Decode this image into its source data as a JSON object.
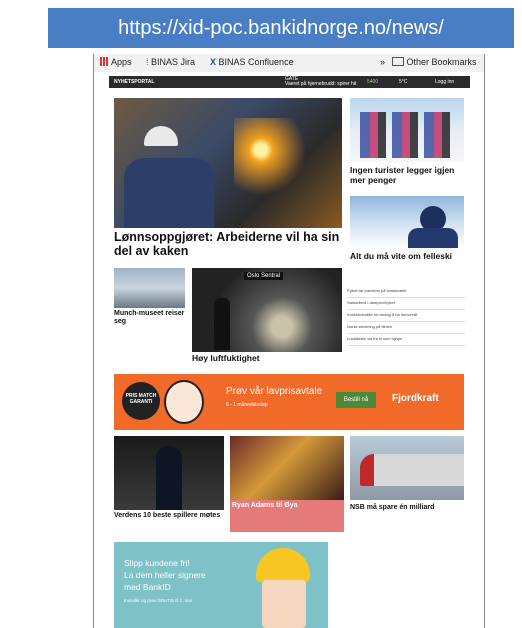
{
  "url": "https://xid-poc.bankidnorge.no/news/",
  "bookmarks": {
    "apps": "Apps",
    "jira": "BINAS Jira",
    "confluence": "BINAS Confluence",
    "more": "»",
    "other": "Other Bookmarks"
  },
  "site": {
    "name": "NYHETSPORTAL",
    "date_label": "GATE",
    "ticker": "Vaeret på hjernebrudd: spirer hit",
    "time": "11:30",
    "stat1": "5400",
    "stat2": "5°C",
    "stat3": "Logg inn"
  },
  "articles": {
    "main": "Lønnsoppgjøret: Arbeiderne vil ha sin del av kaken",
    "tourists": "Ingen turister legger igjen mer penger",
    "felleski": "Alt du må vite om felleski",
    "munch": "Munch-museet reiser seg",
    "luft": "Høy luftfuktighet",
    "oslo_sentral": "Oslo Sentral",
    "players": "Verdens 10 beste spillere møtes",
    "ryan": "Ryan Adams til Øya",
    "nsb": "NSB må spare én milliard"
  },
  "side_list": [
    "Fylket tar pandemi på landsmøtet",
    "Samarbeid i dampen/hytter",
    "Kollektivtrafikk for lørdag å ha henvendt",
    "Norsk stemning på filmen",
    "Lokaliteten tar fra til som hjelpe"
  ],
  "ad": {
    "badge": "PRIS MATCH GARANTI",
    "headline": "Prøv vår lavprisavtale",
    "sub": "6 - 1 månedsbeløp",
    "button": "Bestill nå",
    "brand": "Fjordkraft",
    "colors": {
      "bg": "#f26a2a",
      "button": "#4c8a3a"
    }
  },
  "ad2": {
    "line1": "Slipp kundene fri!",
    "line2": "La dem heller signere",
    "line3": "med BankID",
    "small": "Installér og prøv GRATIS til 1. mai"
  }
}
